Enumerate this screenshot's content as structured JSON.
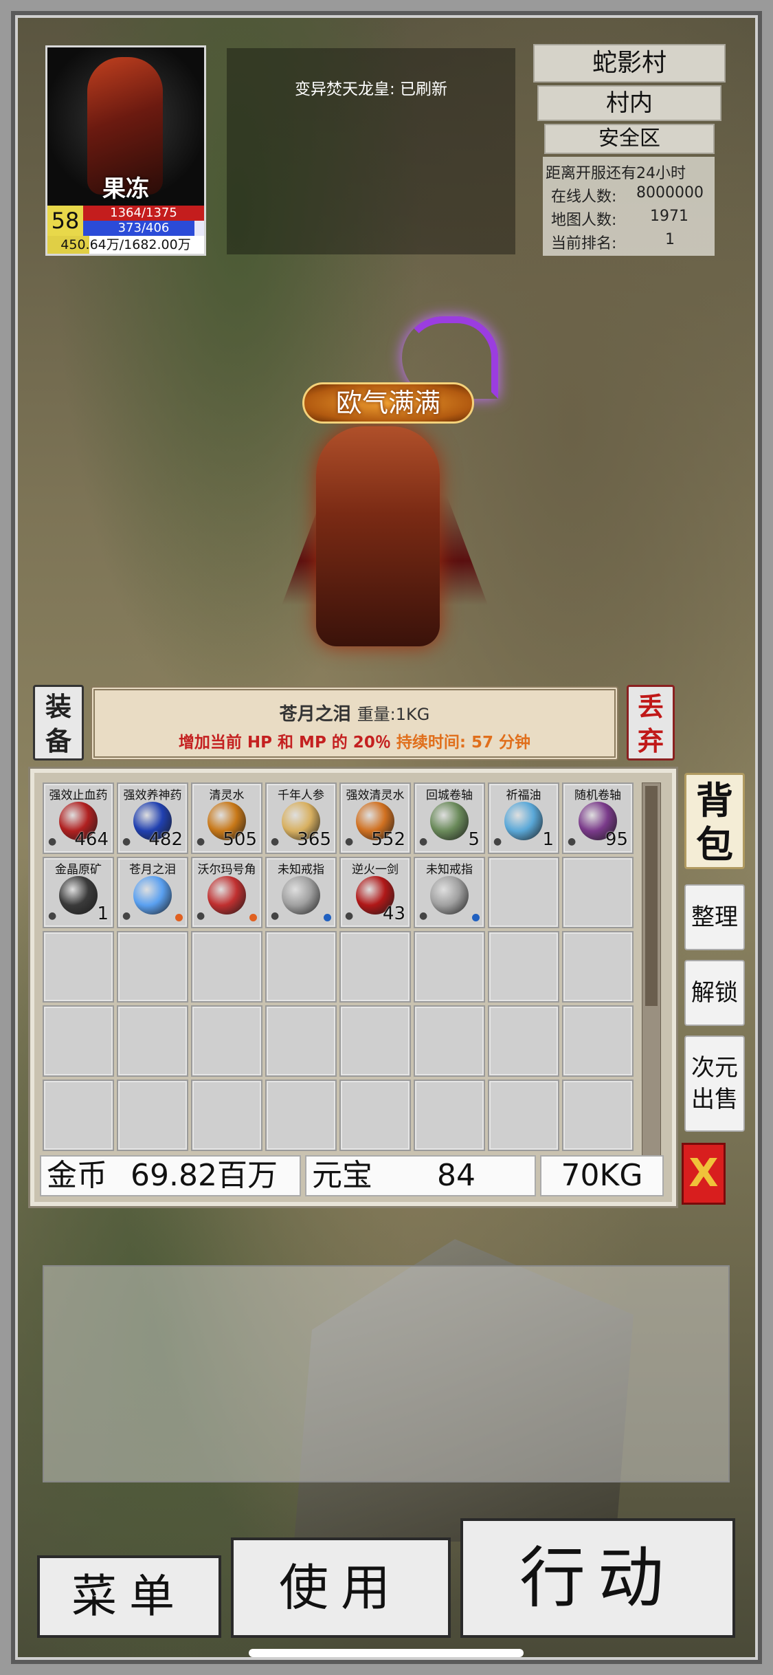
{
  "player": {
    "name": "果冻",
    "level": "58",
    "hp_text": "1364/1375",
    "mp_text": "373/406",
    "mp_fraction": 0.92,
    "exp_text": "450.64万/1682.00万",
    "exp_fraction": 0.268
  },
  "notice": "变异焚天龙皇: 已刷新",
  "location": {
    "map": "蛇影村",
    "area": "村内",
    "zone": "安全区",
    "server_note": "距离开服还有24小时",
    "online_label": "在线人数:",
    "online_value": "8000000",
    "map_label": "地图人数:",
    "map_value": "1971",
    "rank_label": "当前排名:",
    "rank_value": "1"
  },
  "character_title": "欧气满满",
  "selected_item": {
    "equip_label": "装备",
    "name": "苍月之泪",
    "weight": "重量:1KG",
    "desc_main": "增加当前 HP 和 MP 的 20％ ",
    "desc_duration": "持续时间:  57 分钟",
    "discard_label": "丢弃"
  },
  "inventory": {
    "slots": [
      {
        "name": "强效止血药",
        "count": "464",
        "icon": "red-potion-icon",
        "color": "#b02020"
      },
      {
        "name": "强效养神药",
        "count": "482",
        "icon": "blue-potion-icon",
        "color": "#2040b0"
      },
      {
        "name": "清灵水",
        "count": "505",
        "icon": "amber-flask-icon",
        "color": "#c87818"
      },
      {
        "name": "千年人参",
        "count": "365",
        "icon": "ginseng-icon",
        "color": "#d8b060"
      },
      {
        "name": "强效清灵水",
        "count": "552",
        "icon": "orange-flask-icon",
        "color": "#d07020"
      },
      {
        "name": "回城卷轴",
        "count": "5",
        "icon": "scroll-icon",
        "color": "#6a8a5a"
      },
      {
        "name": "祈福油",
        "count": "1",
        "icon": "blue-bottle-icon",
        "color": "#5aa8d8"
      },
      {
        "name": "随机卷轴",
        "count": "95",
        "icon": "purple-scroll-icon",
        "color": "#7a3a8a"
      },
      {
        "name": "金晶原矿",
        "count": "1",
        "icon": "ore-icon",
        "color": "#3a3a3a"
      },
      {
        "name": "苍月之泪",
        "count": "",
        "icon": "blue-crystal-icon",
        "color": "#5aa0f0",
        "dot": "#e06020"
      },
      {
        "name": "沃尔玛号角",
        "count": "",
        "icon": "horn-icon",
        "color": "#c03030",
        "dot": "#e06020"
      },
      {
        "name": "未知戒指",
        "count": "",
        "icon": "ring-icon",
        "color": "#a0a0a0",
        "dot": "#2060c0"
      },
      {
        "name": "逆火一剑",
        "count": "43",
        "icon": "red-book-icon",
        "color": "#b01818"
      },
      {
        "name": "未知戒指",
        "count": "",
        "icon": "ring-icon",
        "color": "#a0a0a0",
        "dot": "#2060c0"
      }
    ],
    "total_slots": 40
  },
  "currency": {
    "gold_label": "金币",
    "gold_value": "69.82百万",
    "yuanbao_label": "元宝",
    "yuanbao_value": "84",
    "weight_value": "70KG"
  },
  "side_buttons": {
    "bag": "背包",
    "sort": "整理",
    "unlock": "解锁",
    "sell_line1": "次元",
    "sell_line2": "出售",
    "close": "X"
  },
  "bottom_buttons": {
    "menu": "菜单",
    "use": "使用",
    "action": "行动"
  },
  "colors": {
    "hp": "#c41d1d",
    "mp": "#2b4bd8",
    "exp": "#e0cf45",
    "desc_red": "#c42020",
    "desc_orange": "#e06f1c",
    "close_bg": "#d81e1e"
  }
}
